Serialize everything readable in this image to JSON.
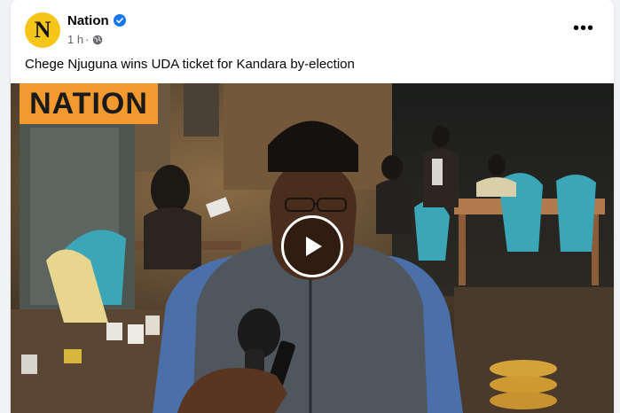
{
  "post": {
    "author": "Nation",
    "avatar_letter": "N",
    "verified": true,
    "time": "1 h",
    "separator": "·",
    "audience_icon": "globe-icon",
    "more_icon": "more-options-icon",
    "more_glyph": "•••",
    "caption": "Chege Njuguna wins UDA ticket for Kandara by-election"
  },
  "video": {
    "watermark": "NATION",
    "play_icon": "play-icon"
  },
  "colors": {
    "verified": "#1877f2",
    "avatar_bg": "#f5c518",
    "watermark_bg": "#f29a2e",
    "meta_text": "#65676b"
  }
}
